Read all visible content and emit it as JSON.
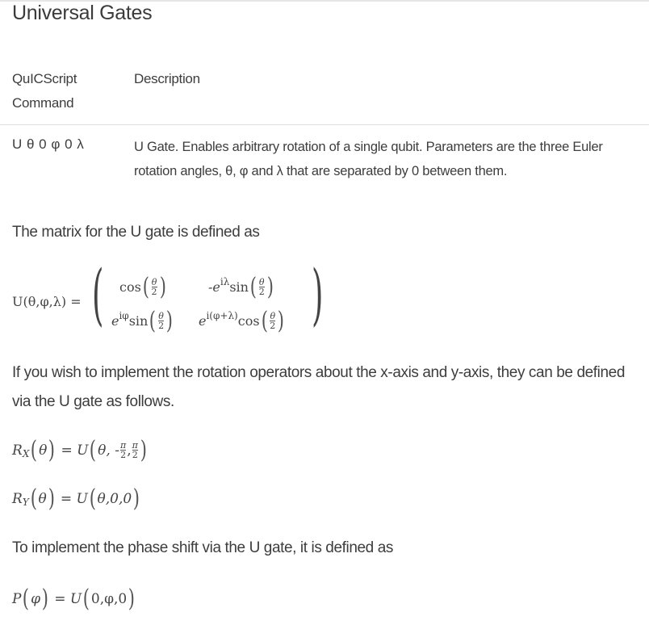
{
  "section": {
    "title": "Universal Gates"
  },
  "table": {
    "headers": [
      "QuICScript\nCommand",
      "Description"
    ],
    "header_command_line1": "QuICScript",
    "header_command_line2": "Command",
    "header_description": "Description",
    "rows": [
      {
        "command": "U θ 0 φ 0 λ",
        "description": "U Gate. Enables arbitrary rotation of a single qubit. Parameters are the three Euler rotation angles, θ, φ and λ that are separated by 0 between them."
      }
    ]
  },
  "paragraphs": {
    "matrix_intro": "The matrix for the U gate is defined as",
    "rotation_intro": "If you wish to implement the rotation operators about the x-axis and y-axis, they can be defined via the U gate as follows.",
    "phase_intro": "To implement the phase shift via the U gate, it is defined as"
  },
  "equations": {
    "u_matrix": {
      "lhs": "U(θ,φ,λ) =",
      "cells": [
        {
          "prefix": "",
          "func": "cos",
          "arg_num": "θ",
          "arg_den": "2"
        },
        {
          "prefix": "-e",
          "sup": "iλ",
          "func": "sin",
          "arg_num": "θ",
          "arg_den": "2"
        },
        {
          "prefix": "e",
          "sup": "iφ",
          "func": "sin",
          "arg_num": "θ",
          "arg_den": "2"
        },
        {
          "prefix": "e",
          "sup": "i(φ+λ)",
          "func": "cos",
          "arg_num": "θ",
          "arg_den": "2"
        }
      ]
    },
    "rx": {
      "name": "R",
      "sub": "X",
      "arg": "θ",
      "eq": "= U",
      "params_start": "θ, -",
      "frac1_num": "π",
      "frac1_den": "2",
      "sep": ",",
      "frac2_num": "π",
      "frac2_den": "2"
    },
    "ry": {
      "name": "R",
      "sub": "Y",
      "arg": "θ",
      "eq": "= U",
      "params": "θ,0,0"
    },
    "p": {
      "name": "P",
      "arg": "φ",
      "eq": "= U",
      "params": "0,φ,0"
    }
  }
}
